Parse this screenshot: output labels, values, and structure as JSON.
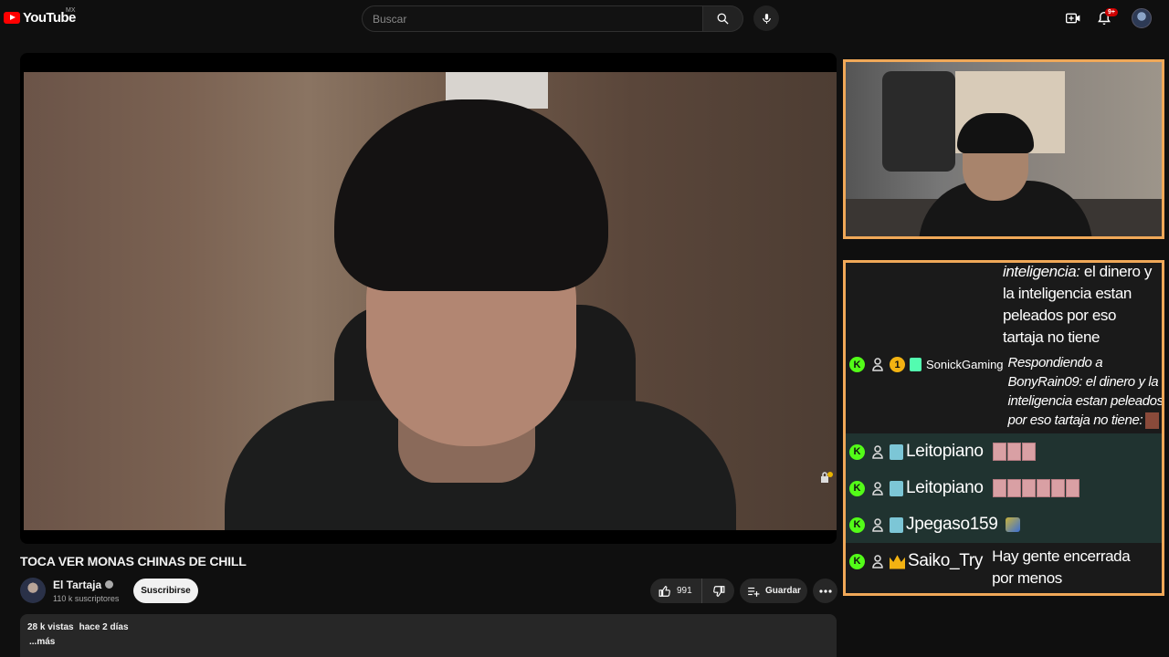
{
  "header": {
    "logo_text": "YouTube",
    "logo_region": "MX",
    "search_placeholder": "Buscar",
    "notifications_badge": "9+"
  },
  "video": {
    "title": "TOCA VER MONAS CHINAS DE CHILL"
  },
  "channel": {
    "name": "El Tartaja",
    "subscribers": "110 k suscriptores",
    "subscribe_label": "Suscribirse"
  },
  "actions": {
    "like_count": "991",
    "save_label": "Guardar"
  },
  "description": {
    "views": "28 k vistas",
    "age": "hace 2 días",
    "more": "...más"
  },
  "chat": {
    "messages": [
      {
        "user": "",
        "prefix": "inteligencia:",
        "text": " el dinero y la inteligencia estan peleados por eso tartaja no tiene"
      },
      {
        "user": "SonickGaming",
        "level": "1",
        "text": "Respondiendo a BonyRain09: el dinero y la inteligencia estan peleados por eso tartaja no tiene:"
      },
      {
        "user": "Leitopiano",
        "emote_count": 3,
        "text": ""
      },
      {
        "user": "Leitopiano",
        "emote_count": 6,
        "text": ""
      },
      {
        "user": "Jpegaso159",
        "text": ""
      },
      {
        "user": "Saiko_Try",
        "text": "Hay gente encerrada por menos"
      }
    ]
  },
  "colors": {
    "accent": "#ff0000",
    "overlay_border": "#f0a858",
    "kick_green": "#53fc18"
  }
}
